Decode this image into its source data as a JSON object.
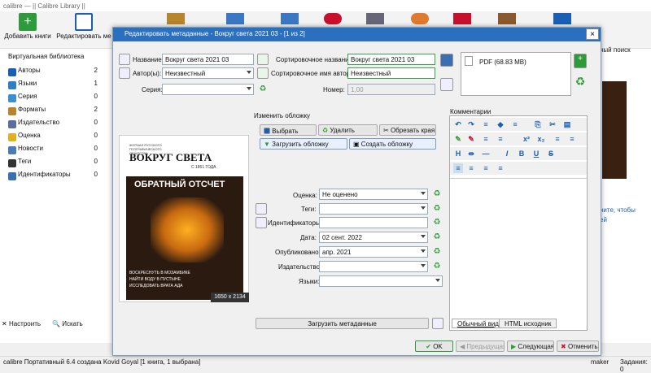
{
  "main": {
    "title": "calibre — || Calibre Library ||",
    "toolbar": [
      {
        "label": "Добавить книги",
        "icon": "add-books-icon"
      },
      {
        "label": "Редактировать ме",
        "icon": "edit-metadata-icon"
      }
    ],
    "sidebar": {
      "virtual_lib": "Виртуальная библиотека",
      "items": [
        {
          "label": "Авторы",
          "count": "2",
          "icon": "authors-icon"
        },
        {
          "label": "Языки",
          "count": "1",
          "icon": "languages-icon"
        },
        {
          "label": "Серия",
          "count": "0",
          "icon": "series-icon"
        },
        {
          "label": "Форматы",
          "count": "2",
          "icon": "formats-icon"
        },
        {
          "label": "Издательство",
          "count": "0",
          "icon": "publisher-icon"
        },
        {
          "label": "Оценка",
          "count": "0",
          "icon": "rating-icon"
        },
        {
          "label": "Новости",
          "count": "0",
          "icon": "news-icon"
        },
        {
          "label": "Теги",
          "count": "0",
          "icon": "tags-icon"
        },
        {
          "label": "Идентификаторы",
          "count": "0",
          "icon": "identifiers-icon"
        }
      ],
      "configure": "Настроить",
      "find": "Искать"
    },
    "right_strip": {
      "text1": "ните, чтобы",
      "text2": "ей",
      "search": "ный поиск"
    },
    "status_left": "calibre Портативный 6.4 создана Kovid Goyal   [1 книга, 1 выбрана]",
    "status_jobs": "Задания: 0",
    "status_maker": "maker"
  },
  "dialog": {
    "title": "Редактировать метаданные - Вокруг света 2021 03 -  [1 из 2]",
    "title_label": "Название:",
    "title_value": "Вокруг света 2021 03",
    "author_label": "Автор(ы):",
    "author_value": "Неизвестный",
    "series_label": "Серия:",
    "series_value": "",
    "sort_title_label": "Сортировочное название:",
    "sort_title_value": "Вокруг света 2021 03",
    "sort_author_label": "Сортировочное имя автора:",
    "sort_author_value": "Неизвестный",
    "number_label": "Номер:",
    "number_value": "1,00",
    "format_entry": "PDF (68.83 MB)",
    "cover_group": "Изменить обложку",
    "btn_choose": "Выбрать",
    "btn_remove": "Удалить",
    "btn_trim": "Обрезать края",
    "btn_download_cover": "Загрузить обложку",
    "btn_generate_cover": "Создать обложку",
    "cover_size": "1650 x 2134",
    "rating_label": "Оценка:",
    "rating_value": "Не оценено",
    "tags_label": "Теги:",
    "ids_label": "Идентификаторы:",
    "date_label": "Дата:",
    "date_value": "02 сент. 2022",
    "published_label": "Опубликовано:",
    "published_value": "апр. 2021",
    "publisher_label": "Издательство:",
    "languages_label": "Языки:",
    "download_metadata": "Загрузить метаданные",
    "comments_label": "Комментарии",
    "tab_normal": "Обычный вид",
    "tab_html": "HTML исходник",
    "btn_ok": "OK",
    "btn_prev": "Предыдущая",
    "btn_next": "Следующая",
    "btn_cancel": "Отменить",
    "cover": {
      "top_small": "ЖУРНАЛ РУССКОГО ГЕОГРАФИЧЕСКОГО ОБЩЕСТВА",
      "masthead": "ВОКРУГ СВЕТА",
      "since": "С 1861 ГОДА",
      "headline": "ОБРАТНЫЙ ОТСЧЕТ",
      "line1": "ВОСКРЕСНУТЬ В МОЗАМБИКЕ",
      "line2": "НАЙТИ ВОДУ В ПУСТЫНЕ",
      "line3": "ИССЛЕДОВАТЬ ВРАТА АДА"
    }
  }
}
